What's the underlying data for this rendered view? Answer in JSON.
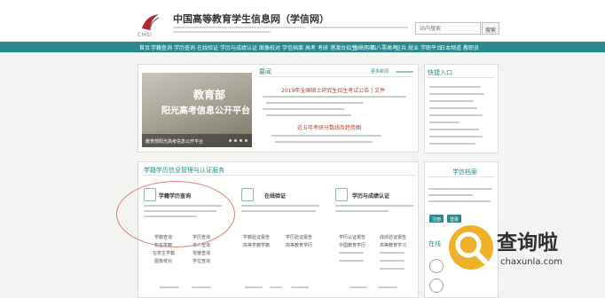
{
  "header": {
    "logo_code": "CHSI",
    "site_name": "中国高等教育学生信息网（学信网）",
    "search": {
      "placeholder": "站内搜索",
      "button": "搜索"
    }
  },
  "nav": {
    "items": [
      "首页",
      "学籍查询",
      "学历查询",
      "在线验证",
      "学历与成绩认证",
      "图像校对",
      "学信档案",
      "高考",
      "考研",
      "港澳台招生",
      "海峡两岸",
      "四八零高考",
      "征兵",
      "就业",
      "学职平台",
      "日本频道",
      "教职员"
    ]
  },
  "news": {
    "title": "要闻",
    "more": "更多新闻",
    "banner": {
      "title": "教育部",
      "subtitle": "阳光高考信息公开平台",
      "caption": "教育部阳光高考信息公开平台"
    },
    "headline_1": "2019年全国硕士研究生招生考试公告 | 文件",
    "headline_2": "近五年考研分数线及趋势图"
  },
  "quick_entry": {
    "title": "快捷入口"
  },
  "services": {
    "title": "学籍学历信息管理与认证服务",
    "cards": [
      {
        "title": "学籍学历查询"
      },
      {
        "title": "在线验证"
      },
      {
        "title": "学历与成绩认证"
      }
    ],
    "links_col1": [
      "学籍查询",
      "新生学籍",
      "在校生学籍",
      "图像校对"
    ],
    "links_col2": [
      "学历查询",
      "本人查询",
      "零散查询",
      "学位查询"
    ],
    "links_col3": [
      "学籍验证报告",
      "高等学籍学籍"
    ],
    "links_col4": [
      "学历验证报告",
      "高等教育学历"
    ],
    "links_col5": [
      "学历认证报告",
      "中国教育学历"
    ],
    "links_col6": [
      "成绩验证报告",
      "高等教育学习"
    ]
  },
  "archive": {
    "title": "学信档案",
    "register": "注册",
    "login": "登录",
    "section_2": "在线"
  },
  "watermark": {
    "brand": "查询啦",
    "url": "chaxunla.com"
  },
  "colors": {
    "primary": "#2a8a8b",
    "headline_red": "#c23a2b",
    "annotation_ring": "#d9807a",
    "watermark_orange": "#f0b02a"
  }
}
